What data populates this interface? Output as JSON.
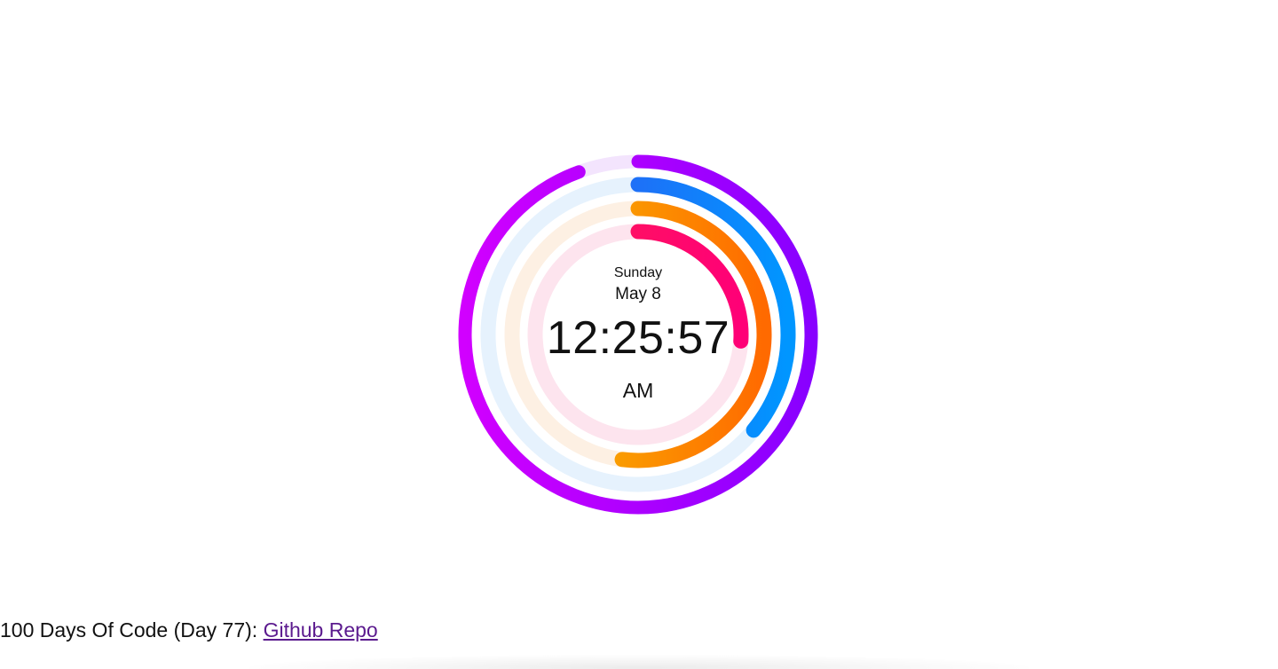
{
  "clock": {
    "weekday": "Sunday",
    "date": "May 8",
    "time": "12:25:57",
    "period": "AM",
    "rings": [
      {
        "name": "month",
        "fraction": 0.944,
        "colors": [
          "#d100ff",
          "#8800ff"
        ],
        "track": "#f3e4fd"
      },
      {
        "name": "day",
        "fraction": 0.36,
        "colors": [
          "#3a4cf0",
          "#0096ff"
        ],
        "track": "#e6f2fd"
      },
      {
        "name": "hour",
        "fraction": 0.52,
        "colors": [
          "#f7bf00",
          "#ff6a00"
        ],
        "track": "#fdf0e3"
      },
      {
        "name": "minute",
        "fraction": 0.26,
        "colors": [
          "#ff1a55",
          "#ff0077"
        ],
        "track": "#fde4ee"
      }
    ]
  },
  "footer": {
    "text": "100 Days Of Code (Day 77): ",
    "link_label": "Github Repo"
  }
}
